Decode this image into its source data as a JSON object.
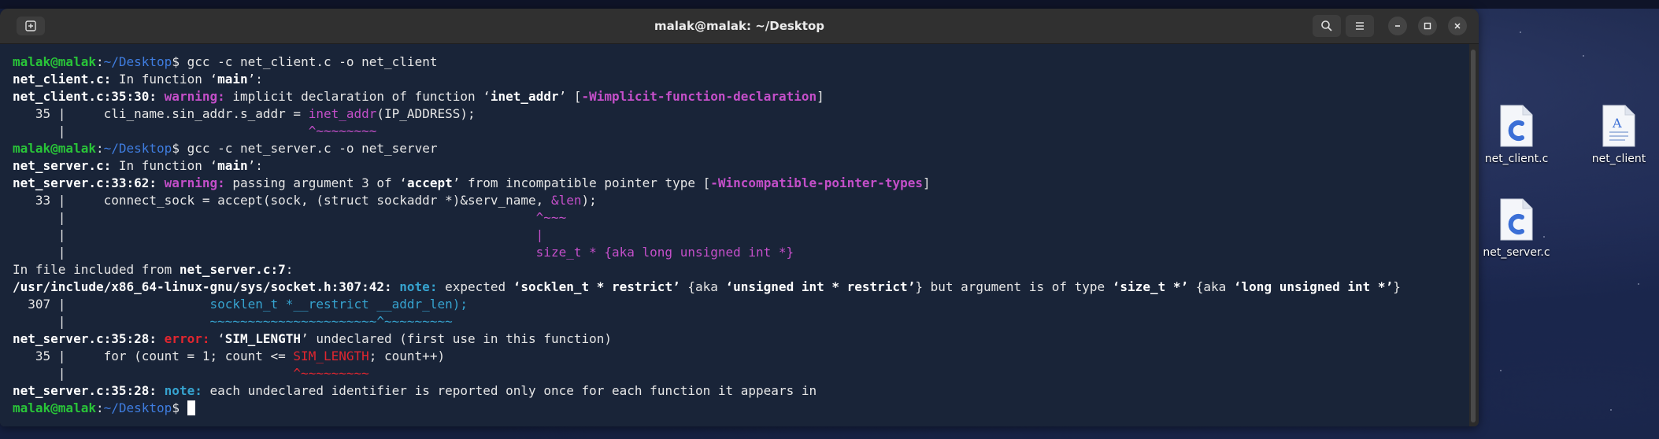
{
  "window": {
    "title": "malak@malak: ~/Desktop"
  },
  "terminal": {
    "l1": {
      "user": "malak@malak",
      "path": "~/Desktop",
      "cmd": "gcc -c net_client.c -o net_client"
    },
    "l2": {
      "file": "net_client.c:",
      "text": " In function ",
      "q1": "‘",
      "fn": "main",
      "q2": "’:"
    },
    "l3": {
      "loc": "net_client.c:35:30:",
      "kind": "warning:",
      "t1": " implicit declaration of function ",
      "q1": "‘",
      "fn": "inet_addr",
      "q2": "’",
      "t2": " [",
      "flag": "-Wimplicit-function-declaration",
      "t3": "]"
    },
    "l4": {
      "gutter": "   35 |     ",
      "pre": "cli_name.sin_addr.s_addr = ",
      "hl": "inet_addr",
      "post": "(IP_ADDRESS);"
    },
    "l5": {
      "gutter": "      |",
      "pad": "                                ",
      "mark": "^~~~~~~~~"
    },
    "l6": {
      "user": "malak@malak",
      "path": "~/Desktop",
      "cmd": "gcc -c net_server.c -o net_server"
    },
    "l7": {
      "file": "net_server.c:",
      "text": " In function ",
      "q1": "‘",
      "fn": "main",
      "q2": "’:"
    },
    "l8": {
      "loc": "net_server.c:33:62:",
      "kind": "warning:",
      "t1": " passing argument 3 of ",
      "q1": "‘",
      "fn": "accept",
      "q2": "’",
      "t2": " from incompatible pointer type [",
      "flag": "-Wincompatible-pointer-types",
      "t3": "]"
    },
    "l9": {
      "gutter": "   33 |     ",
      "pre": "connect_sock = accept(sock, (struct sockaddr *)&serv_name, ",
      "hl": "&len",
      "post": ");"
    },
    "l10": {
      "gutter": "      |",
      "pad": "                                                              ",
      "mark": "^~~~"
    },
    "l11": {
      "gutter": "      |",
      "pad": "                                                              ",
      "mark": "|"
    },
    "l12": {
      "gutter": "      |",
      "pad": "                                                              ",
      "mark": "size_t * {aka long unsigned int *}"
    },
    "l13": {
      "text": "In file included from ",
      "file": "net_server.c:7",
      "colon": ":"
    },
    "l14": {
      "loc": "/usr/include/x86_64-linux-gnu/sys/socket.h:307:42:",
      "kind": "note:",
      "t1": " expected ",
      "a": "‘socklen_t * restrict’",
      "t2": " {aka ",
      "b": "‘unsigned int * restrict’",
      "t3": "} but argument is of type ",
      "c": "‘size_t *’",
      "t4": " {aka ",
      "d": "‘long unsigned int *’",
      "t5": "}"
    },
    "l15": {
      "gutter": "  307 |                   ",
      "code": "socklen_t *__restrict __addr_len);"
    },
    "l16": {
      "gutter": "      |",
      "pad": "                   ",
      "mark": "~~~~~~~~~~~~~~~~~~~~~~^~~~~~~~~~"
    },
    "l17": {
      "loc": "net_server.c:35:28:",
      "kind": "error:",
      "q1": " ‘",
      "fn": "SIM_LENGTH",
      "q2": "’",
      "t1": " undeclared (first use in this function)"
    },
    "l18": {
      "gutter": "   35 |     ",
      "pre": "for (count = 1; count <= ",
      "hl": "SIM_LENGTH",
      "post": "; count++)"
    },
    "l19": {
      "gutter": "      |",
      "pad": "                              ",
      "mark": "^~~~~~~~~~"
    },
    "l20": {
      "loc": "net_server.c:35:28:",
      "kind": "note:",
      "t1": " each undeclared identifier is reported only once for each function it appears in"
    },
    "l21": {
      "user": "malak@malak",
      "path": "~/Desktop"
    }
  },
  "desktop": [
    {
      "label": "net_client.c",
      "icon": "c-source-file-icon"
    },
    {
      "label": "net_client",
      "icon": "text-document-icon"
    },
    {
      "label": "net_server.c",
      "icon": "c-source-file-icon"
    }
  ]
}
